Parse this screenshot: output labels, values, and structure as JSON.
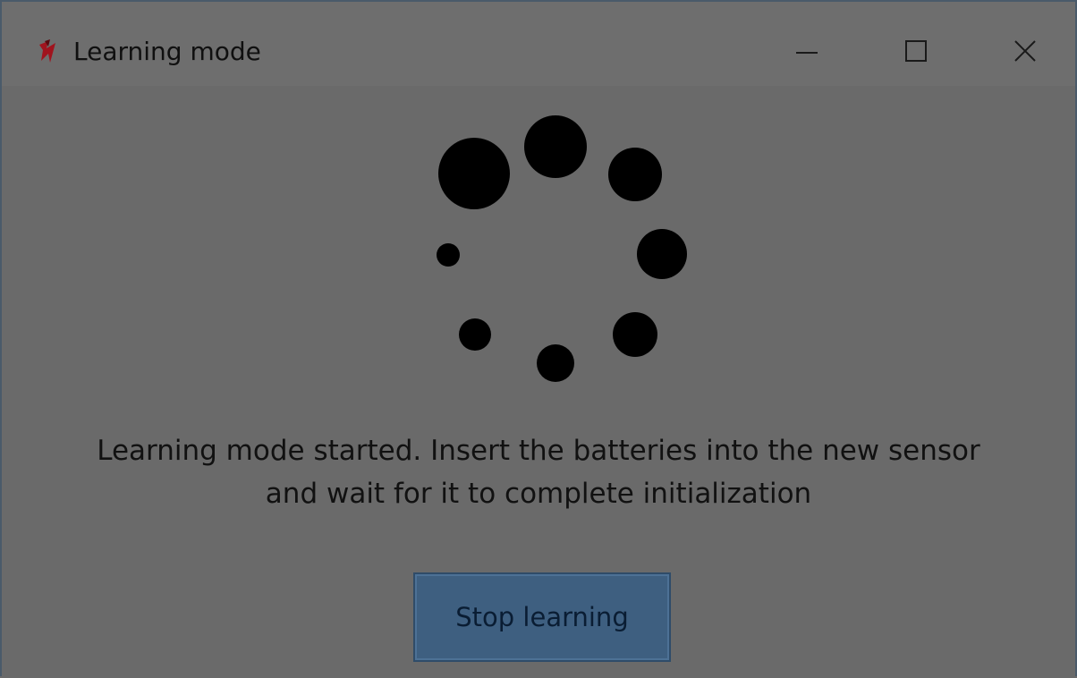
{
  "window": {
    "title": "Learning mode",
    "icon": "red-bolt-icon"
  },
  "titlebar_controls": {
    "minimize": "minimize-icon",
    "maximize": "maximize-icon",
    "close": "close-icon"
  },
  "spinner": {
    "icon": "loading-spinner-icon"
  },
  "message": {
    "line1": "Learning mode started. Insert the batteries into the new sensor",
    "line2": "and wait for it to complete initialization"
  },
  "actions": {
    "stop_label": "Stop learning"
  },
  "colors": {
    "background": "#6b6b6b",
    "button": "#3e5f80",
    "button_text": "#0a1d33",
    "icon_accent": "#a0141e"
  }
}
